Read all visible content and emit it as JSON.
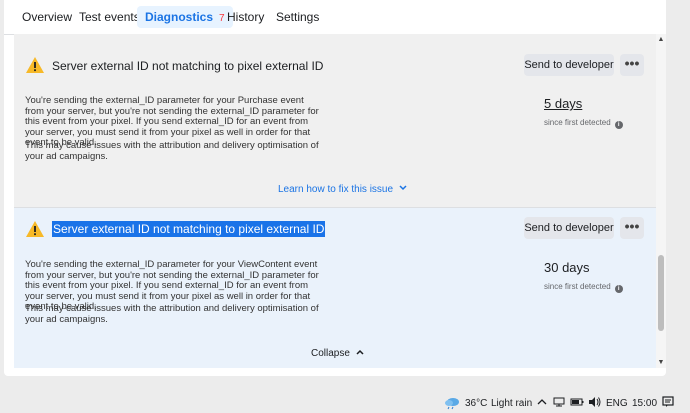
{
  "tabs": [
    {
      "label": "Overview"
    },
    {
      "label": "Test events"
    },
    {
      "label": "Diagnostics",
      "badge": "7"
    },
    {
      "label": "History"
    },
    {
      "label": "Settings"
    }
  ],
  "issues": [
    {
      "title": "Server external ID not matching to pixel external ID",
      "send_label": "Send to developer",
      "more_label": "•••",
      "description": "You're sending the external_ID parameter for your Purchase event from your server, but you're not sending the external_ID parameter for this event from your pixel. If you send external_ID for an event from your server, you must send it from your pixel as well in order for that event to be valid.",
      "impact": "This may cause issues with the attribution and delivery optimisation of your ad campaigns.",
      "days": "5 days",
      "since": "since first detected",
      "link": "Learn how to fix this issue"
    },
    {
      "title": "Server external ID not matching to pixel external ID",
      "send_label": "Send to developer",
      "more_label": "•••",
      "description": "You're sending the external_ID parameter for your ViewContent event from your server, but you're not sending the external_ID parameter for this event from your pixel. If you send external_ID for an event from your server, you must send it from your pixel as well in order for that event to be valid.",
      "impact": "This may cause issues with the attribution and delivery optimisation of your ad campaigns.",
      "days": "30 days",
      "since": "since first detected",
      "link": "Collapse"
    }
  ],
  "taskbar": {
    "temperature": "36°C",
    "weather": "Light rain",
    "language": "ENG",
    "time": "15:00"
  },
  "colors": {
    "accent": "#1b74e4",
    "warning": "#f7b928",
    "badge": "#fa383e",
    "selection": "#1a73e8"
  }
}
